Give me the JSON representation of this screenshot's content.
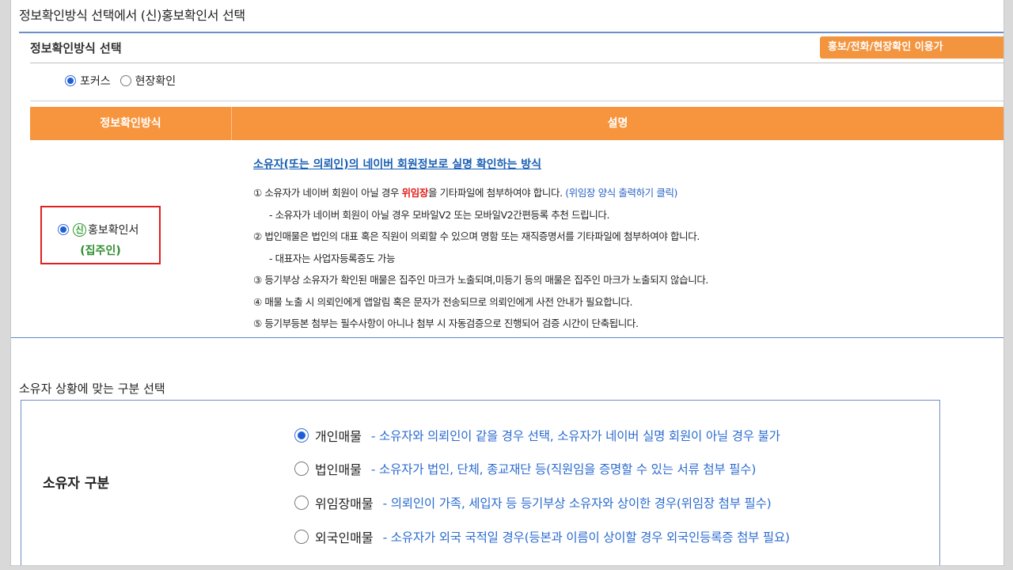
{
  "heading": "정보확인방식 선택에서 (신)홍보확인서 선택",
  "info_method": {
    "title": "정보확인방식 선택",
    "promo_button": "홍보/전화/현장확인 이용가",
    "options": [
      {
        "label": "포커스",
        "selected": true
      },
      {
        "label": "현장확인",
        "selected": false
      }
    ]
  },
  "table": {
    "col1_header": "정보확인방식",
    "col2_header": "설명",
    "method": {
      "badge": "신",
      "label": "홍보확인서",
      "sublabel": "(집주인)",
      "selected": true
    },
    "desc_title": "소유자(또는 의뢰인)의 네이버 회원정보로 실명 확인하는 방식",
    "line1_a": "① 소유자가 네이버 회원이 아닐 경우 ",
    "line1_red": "위임장",
    "line1_b": "을 기타파일에 첨부하여야 합니다. ",
    "line1_link": "(위임장 양식 출력하기 클릭)",
    "line2": "- 소유자가 네이버 회원이 아닐 경우 모바일V2 또는 모바일V2간편등록 추천 드립니다.",
    "line3": "② 법인매물은 법인의 대표 혹은 직원이 의뢰할 수 있으며 명함 또는 재직증명서를 기타파일에 첨부하여야 합니다.",
    "line4": "- 대표자는 사업자등록증도 가능",
    "line5": "③ 등기부상 소유자가 확인된 매물은 집주인 마크가 노출되며,미등기 등의 매물은 집주인 마크가 노출되지 않습니다.",
    "line6": "④ 매물 노출 시 의뢰인에게 앱알림 혹은 문자가 전송되므로 의뢰인에게 사전 안내가 필요합니다.",
    "line7": "⑤ 등기부등본 첨부는 필수사항이 아니나 첨부 시 자동검증으로 진행되어 검증 시간이 단축됩니다."
  },
  "owner_section": {
    "title": "소유자 상황에 맞는 구분 선택",
    "label": "소유자 구분",
    "options": [
      {
        "label": "개인매물",
        "desc": "- 소유자와 의뢰인이 같을 경우 선택, 소유자가 네이버 실명 회원이 아닐 경우 불가",
        "selected": true
      },
      {
        "label": "법인매물",
        "desc": "- 소유자가 법인, 단체, 종교재단 등(직원임을 증명할 수 있는 서류 첨부 필수)",
        "selected": false
      },
      {
        "label": "위임장매물",
        "desc": "- 의뢰인이 가족, 세입자 등 등기부상 소유자와 상이한 경우(위임장 첨부 필수)",
        "selected": false
      },
      {
        "label": "외국인매물",
        "desc": "- 소유자가 외국 국적일 경우(등본과 이름이 상이할 경우 외국인등록증 첨부 필요)",
        "selected": false
      }
    ]
  }
}
